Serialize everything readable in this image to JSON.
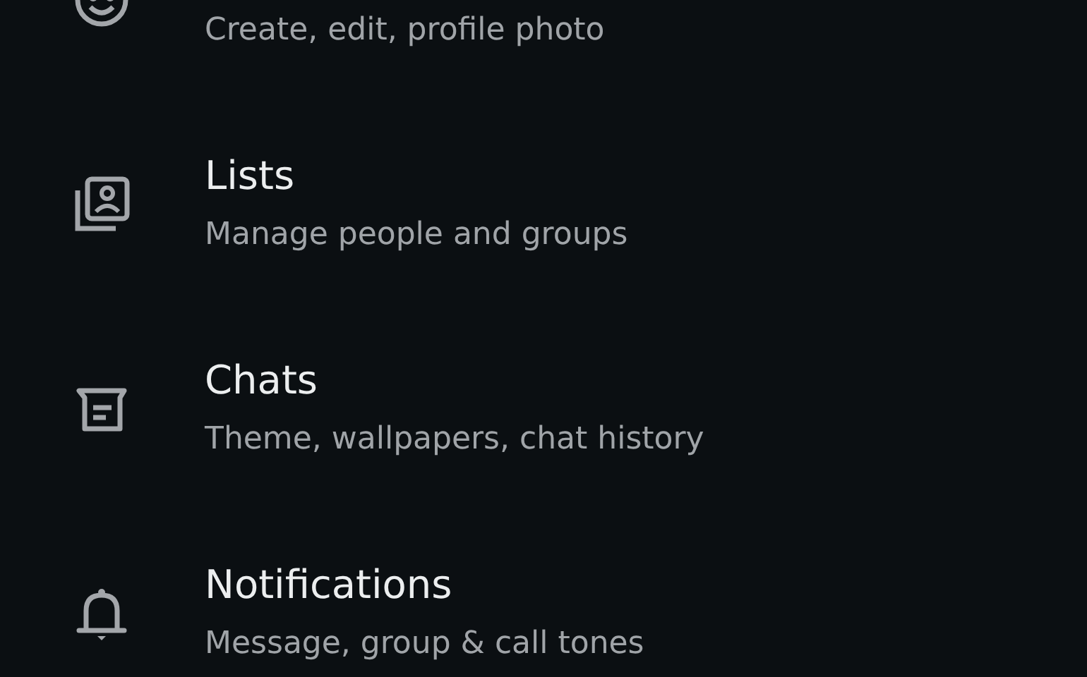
{
  "settings": [
    {
      "kind": "avatar",
      "subtitle": "Create, edit, profile photo"
    },
    {
      "kind": "lists",
      "title": "Lists",
      "subtitle": "Manage people and groups"
    },
    {
      "kind": "chats",
      "title": "Chats",
      "subtitle": "Theme, wallpapers, chat history"
    },
    {
      "kind": "notifications",
      "title": "Notifications",
      "subtitle": "Message, group & call tones"
    }
  ]
}
